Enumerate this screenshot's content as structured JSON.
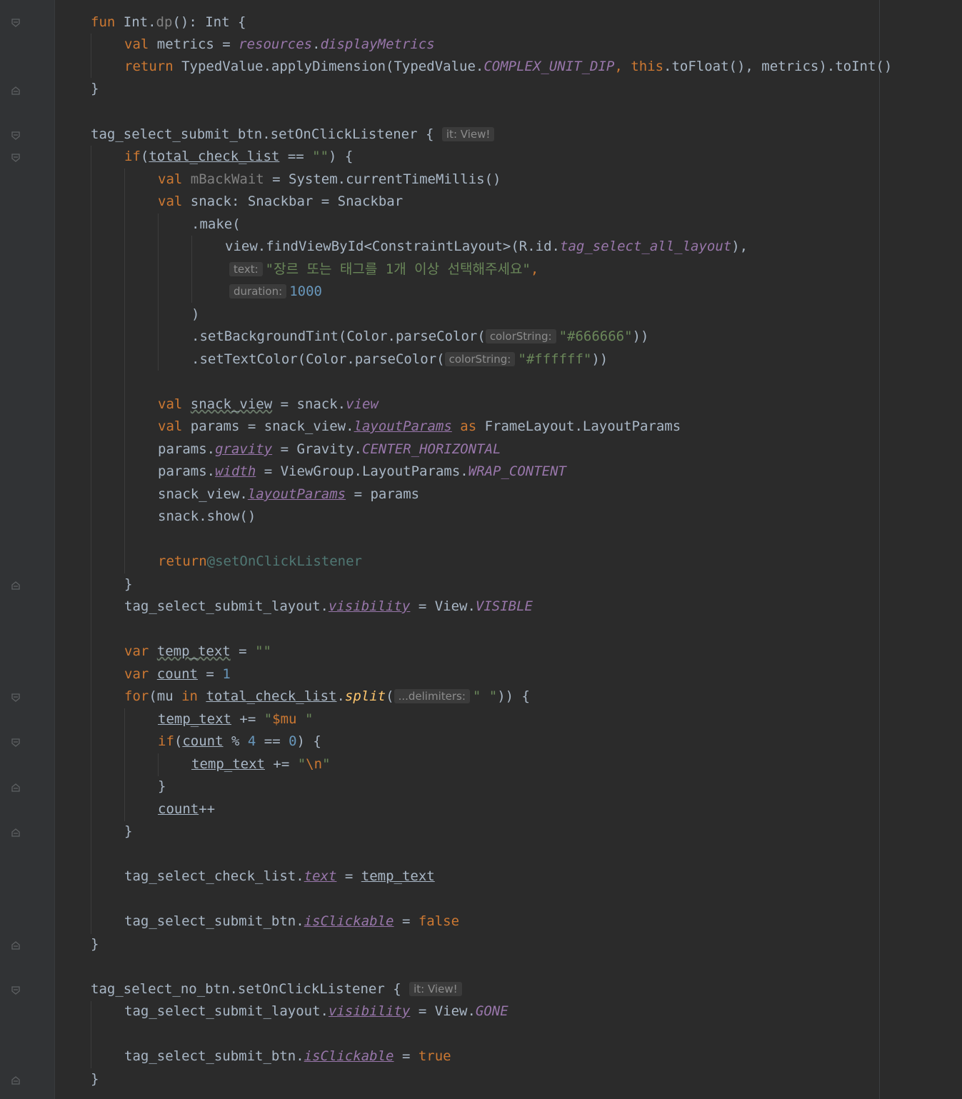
{
  "editor": {
    "code": {
      "fun_decl": {
        "kw": "fun",
        "recv": "Int.",
        "name": "dp",
        "rest": "(): Int {"
      },
      "metrics_line": {
        "kw": "val",
        "name": " metrics = ",
        "prop1": "resources",
        "dot": ".",
        "prop2": "displayMetrics"
      },
      "return_line": {
        "kw": "return",
        "pre": " TypedValue.applyDimension(TypedValue.",
        "const": "COMPLEX_UNIT_DIP",
        "comma": ", ",
        "this": "this",
        "post": ".toFloat(), metrics).toInt()"
      },
      "close_brace": "}",
      "submit_listener": {
        "text": "tag_select_submit_btn.setOnClickListener { ",
        "hint": "it: View!"
      },
      "if_line": {
        "kw": "if",
        "open": "(",
        "var": "total_check_list",
        "op": " == ",
        "str": "\"\"",
        "close": ") {"
      },
      "mbackwait_line": {
        "kw": "val",
        "sp": " ",
        "name": "mBackWait",
        "rest": " = System.currentTimeMillis()"
      },
      "snack_decl": {
        "kw": "val",
        "rest": " snack: Snackbar = Snackbar"
      },
      "make_line": ".make(",
      "findview_line": {
        "pre": "view.findViewById<ConstraintLayout>(R.id.",
        "id": "tag_select_all_layout",
        "post": "),"
      },
      "text_arg": {
        "hint": "text:",
        "str": "\"장르 또는 태그를 1개 이상 선택해주세요\"",
        "comma": ","
      },
      "duration_arg": {
        "hint": "duration:",
        "num": "1000"
      },
      "close_paren": ")",
      "bg_tint": {
        "pre": ".setBackgroundTint(Color.parseColor(",
        "hint": "colorString:",
        "str": "\"#666666\"",
        "post": "))"
      },
      "text_color": {
        "pre": ".setTextColor(Color.parseColor(",
        "hint": "colorString:",
        "str": "\"#ffffff\"",
        "post": "))"
      },
      "snack_view_line": {
        "kw": "val",
        "sp": " ",
        "name": "snack_view",
        "mid": " = snack.",
        "prop": "view"
      },
      "params_line": {
        "kw": "val",
        "mid": " params = snack_view.",
        "prop": "layoutParams",
        "sp": " ",
        "as": "as",
        "post": " FrameLayout.LayoutParams"
      },
      "gravity_line": {
        "pre": "params.",
        "prop": "gravity",
        "mid": " = Gravity.",
        "const": "CENTER_HORIZONTAL"
      },
      "width_line": {
        "pre": "params.",
        "prop": "width",
        "mid": " = ViewGroup.LayoutParams.",
        "const": "WRAP_CONTENT"
      },
      "layoutparams_assign": {
        "pre": "snack_view.",
        "prop": "layoutParams",
        "post": " = params"
      },
      "show_line": "snack.show()",
      "return_label": {
        "kw": "return",
        "label": "@setOnClickListener"
      },
      "visible_line": {
        "pre": "tag_select_submit_layout.",
        "prop": "visibility",
        "mid": " = View.",
        "const": "VISIBLE"
      },
      "temp_text_decl": {
        "kw": "var",
        "sp": " ",
        "name": "temp_text",
        "mid": " = ",
        "str": "\"\""
      },
      "count_decl": {
        "kw": "var",
        "sp": " ",
        "name": "count",
        "mid": " = ",
        "num": "1"
      },
      "for_line": {
        "kw": "for",
        "p1": "(mu ",
        "in": "in",
        "sp": " ",
        "var": "total_check_list",
        "dot": ".",
        "fn": "split",
        "open": "(",
        "hint": "...delimiters:",
        "str": "\" \"",
        "close": ")) {"
      },
      "temp_append": {
        "name": "temp_text",
        "op": " += ",
        "s1": "\"",
        "dollar": "$mu",
        "s2": " \""
      },
      "if_count": {
        "kw": "if",
        "open": "(",
        "var": "count",
        "op": " % ",
        "n1": "4",
        "eq": " == ",
        "n2": "0",
        "close": ") {"
      },
      "newline_append": {
        "name": "temp_text",
        "op": " += ",
        "s1": "\"",
        "esc": "\\n",
        "s2": "\""
      },
      "count_inc": {
        "var": "count",
        "op": "++"
      },
      "check_list_line": {
        "pre": "tag_select_check_list.",
        "prop": "text",
        "mid": " = ",
        "var": "temp_text"
      },
      "clickable_false": {
        "pre": "tag_select_submit_btn.",
        "prop": "isClickable",
        "mid": " = ",
        "val": "false"
      },
      "no_listener": {
        "text": "tag_select_no_btn.setOnClickListener { ",
        "hint": "it: View!"
      },
      "gone_line": {
        "pre": "tag_select_submit_layout.",
        "prop": "visibility",
        "mid": " = View.",
        "const": "GONE"
      },
      "clickable_true": {
        "pre": "tag_select_submit_btn.",
        "prop": "isClickable",
        "mid": " = ",
        "val": "true"
      }
    }
  },
  "colors": {
    "background": "#2b2b2b",
    "gutter": "#313335",
    "default_text": "#a9b7c6",
    "keyword": "#cc7832",
    "string": "#6a8759",
    "number": "#6897bb",
    "property": "#9876aa",
    "function": "#ffc66d"
  }
}
